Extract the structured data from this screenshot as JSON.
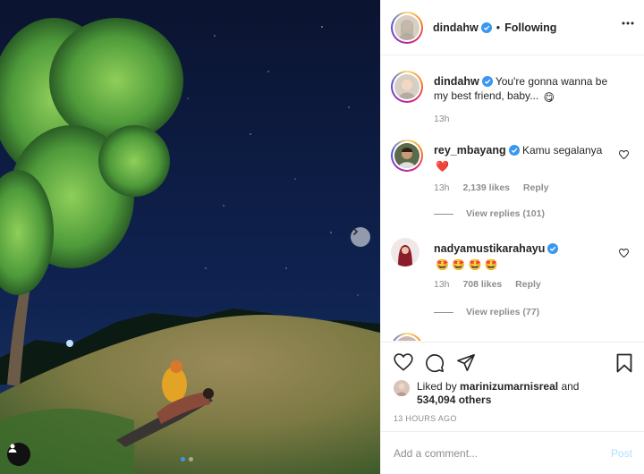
{
  "post": {
    "author": "dindahw",
    "follow_state": "Following",
    "separator": "•",
    "caption": "You're gonna wanna be my best friend, baby...",
    "caption_emoji": "😋",
    "caption_time": "13h",
    "carousel": {
      "slides": 2,
      "current": 1
    }
  },
  "comments": [
    {
      "user": "rey_mbayang",
      "text": "Kamu segalanya",
      "emoji": "❤️",
      "time": "13h",
      "likes": "2,139 likes",
      "reply_label": "Reply",
      "view_replies": "View replies (101)"
    },
    {
      "user": "nadyamustikarahayu",
      "text": "",
      "emoji": "🤩 🤩 🤩 🤩",
      "time": "13h",
      "likes": "708 likes",
      "reply_label": "Reply",
      "view_replies": "View replies (77)"
    }
  ],
  "likes": {
    "prefix": "Liked by",
    "user": "marinizumarnisreal",
    "and": "and",
    "others": "534,094 others"
  },
  "timestamp": "13 HOURS AGO",
  "add_comment": {
    "placeholder": "Add a comment...",
    "post_label": "Post"
  },
  "colors": {
    "verified": "#3897f0",
    "heart": "#ed4956",
    "post_disabled": "#b2dffc",
    "muted": "#8e8e8e"
  },
  "icons": [
    "more-options-icon",
    "verified-badge-icon",
    "heart-icon",
    "comment-icon",
    "share-icon",
    "bookmark-icon",
    "next-arrow-icon",
    "tag-user-icon"
  ]
}
